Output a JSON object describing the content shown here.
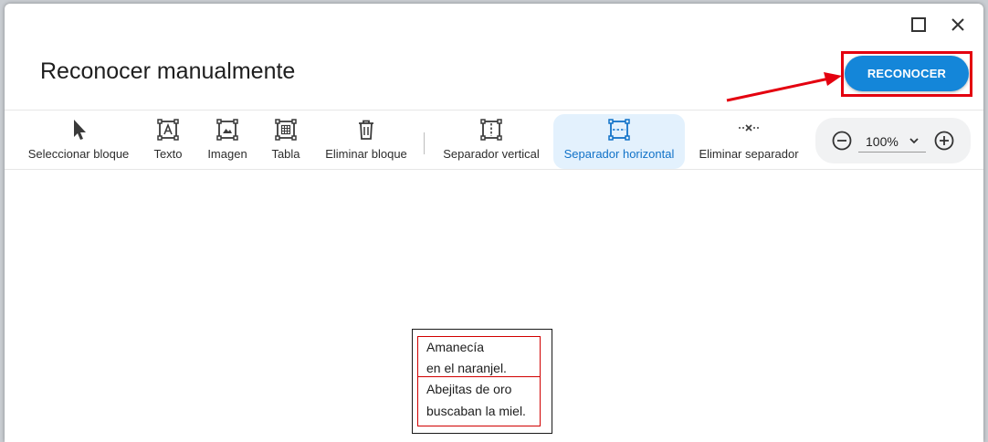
{
  "dialog": {
    "title": "Reconocer manualmente",
    "recognize_label": "RECONOCER",
    "window_controls": [
      "maximize-icon",
      "close-icon"
    ]
  },
  "toolbar": {
    "tools": [
      {
        "label": "Seleccionar bloque",
        "icon": "cursor-arrow-icon",
        "active": false
      },
      {
        "label": "Texto",
        "icon": "text-block-icon",
        "active": false
      },
      {
        "label": "Imagen",
        "icon": "image-block-icon",
        "active": false
      },
      {
        "label": "Tabla",
        "icon": "table-block-icon",
        "active": false
      },
      {
        "label": "Eliminar bloque",
        "icon": "trash-icon",
        "active": false
      },
      {
        "label": "Separador vertical",
        "icon": "vertical-separator-icon",
        "active": false
      },
      {
        "label": "Separador horizontal",
        "icon": "horizontal-separator-icon",
        "active": true
      },
      {
        "label": "Eliminar separador",
        "icon": "remove-separator-icon",
        "active": false
      }
    ],
    "zoom": {
      "value": "100%",
      "decrease_icon": "zoom-out-icon",
      "increase_icon": "zoom-in-icon"
    }
  },
  "document": {
    "lines": [
      "Amanecía",
      "en el naranjel.",
      "Abejitas de oro",
      "buscaban la miel."
    ]
  },
  "colors": {
    "accent": "#1486d9",
    "active_tool_bg": "#e3f1fd",
    "active_tool_text": "#1172c8",
    "annotation_red": "#e4000f"
  }
}
